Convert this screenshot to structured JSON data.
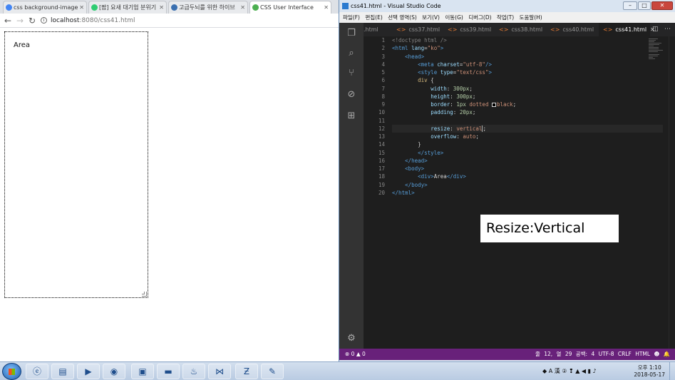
{
  "chrome": {
    "tabs": [
      {
        "label": "css background-image",
        "color": "#4285f4"
      },
      {
        "label": "[팝] 요새 대기업 분위기",
        "color": "#2ecc71"
      },
      {
        "label": "고급두뇌를 위한 하이브",
        "color": "#3a6fb0"
      },
      {
        "label": "CSS User Interface",
        "color": "#4caf50"
      }
    ],
    "url_host": "localhost",
    "url_rest": ":8080/css41.html",
    "page_div_text": "Area"
  },
  "vscode": {
    "title": "css41.html - Visual Studio Code",
    "menu": [
      "파일(F)",
      "편집(E)",
      "선택 영역(S)",
      "보기(V)",
      "이동(G)",
      "디버그(D)",
      "작업(T)",
      "도움말(H)"
    ],
    "tabs": [
      ".html",
      "css37.html",
      "css39.html",
      "css38.html",
      "css40.html",
      "css41.html"
    ],
    "active_tab": "css41.html",
    "line_numbers": [
      "1",
      "2",
      "3",
      "4",
      "5",
      "6",
      "7",
      "8",
      "9",
      "10",
      "11",
      "12",
      "13",
      "14",
      "15",
      "16",
      "17",
      "18",
      "19",
      "20"
    ],
    "code": {
      "l1": "<!doctype html />",
      "l2a": "<html ",
      "l2b": "lang",
      "l2c": "=",
      "l2d": "\"ko\"",
      "l2e": ">",
      "l3": "<head>",
      "l4a": "<meta ",
      "l4b": "charset",
      "l4c": "=",
      "l4d": "\"utf-8\"",
      "l4e": "/>",
      "l5a": "<style ",
      "l5b": "type",
      "l5c": "=",
      "l5d": "\"text/css\"",
      "l5e": ">",
      "l6a": "div",
      "l6b": " {",
      "l7a": "width",
      "l7b": ": ",
      "l7c": "300px",
      "l7d": ";",
      "l8a": "height",
      "l8b": ": ",
      "l8c": "300px",
      "l8d": ";",
      "l9a": "border",
      "l9b": ": ",
      "l9c": "1px",
      "l9d": " dotted ",
      "l9e": "black",
      "l9f": ";",
      "l10a": "padding",
      "l10b": ": ",
      "l10c": "20px",
      "l10d": ";",
      "l12a": "resize",
      "l12b": ": ",
      "l12c": "vertical",
      "l12d": ";",
      "l13a": "overflow",
      "l13b": ": ",
      "l13c": "auto",
      "l13d": ";",
      "l14": "}",
      "l15": "</style>",
      "l16": "</head>",
      "l17": "<body>",
      "l18a": "<div>",
      "l18b": "Area",
      "l18c": "</div>",
      "l19": "</body>",
      "l20": "</html>"
    },
    "annotation": "Resize:Vertical",
    "status_left": "⊗ 0 ▲ 0",
    "status_right": "줄 12, 열 29   공백: 4   UTF-8   CRLF   HTML   ☻   🔔"
  },
  "taskbar": {
    "apps": [
      "ie-icon",
      "explorer-icon",
      "media-player-icon",
      "chrome-icon",
      "pdf-icon",
      "cmd-icon",
      "java-icon",
      "vscode-icon",
      "filezilla-icon",
      "notepad-icon"
    ],
    "tray_icons": "◆ A 漢 ② ❢ ▲ ◀ ▮ ♪",
    "clock_time": "오후 1:10",
    "clock_date": "2018-05-17"
  }
}
